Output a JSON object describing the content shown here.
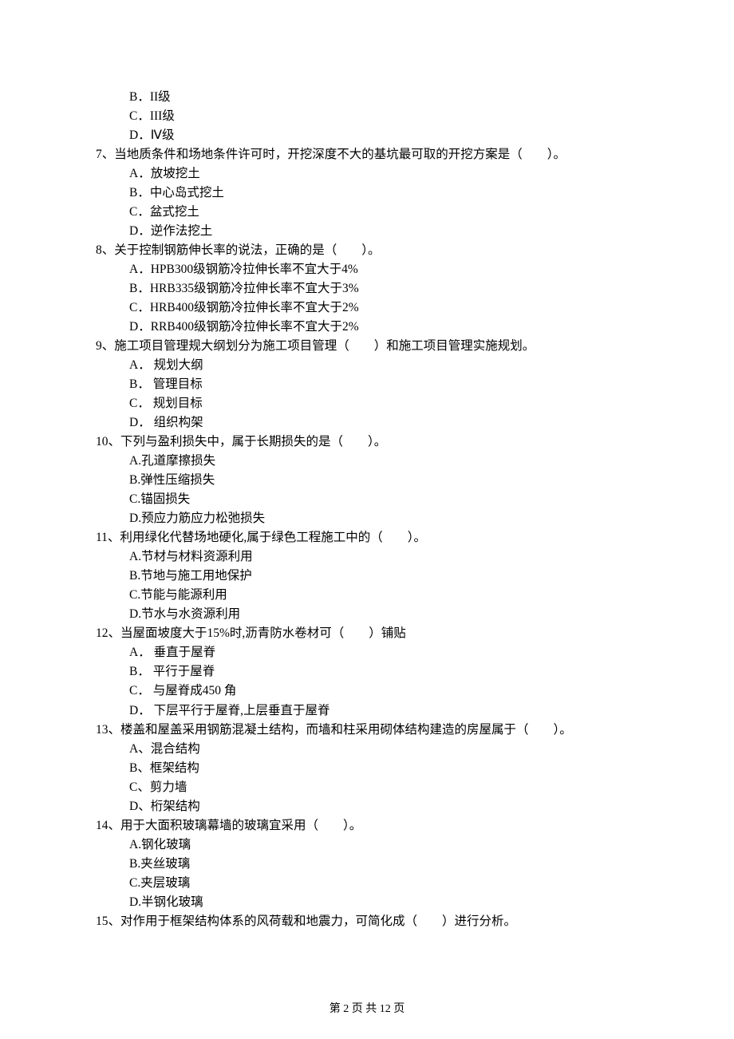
{
  "footer": "第 2 页 共 12 页",
  "opts_pre": [
    "B．II级",
    "C．III级",
    "D．Ⅳ级"
  ],
  "questions": [
    {
      "stem": "7、当地质条件和场地条件许可时，开挖深度不大的基坑最可取的开挖方案是（　　）。",
      "opts": [
        "A．放坡挖土",
        "B．中心岛式挖土",
        "C．盆式挖土",
        "D．逆作法挖土"
      ]
    },
    {
      "stem": "8、关于控制钢筋伸长率的说法，正确的是（　　）。",
      "opts": [
        "A．HPB300级钢筋冷拉伸长率不宜大于4%",
        "B．HRB335级钢筋冷拉伸长率不宜大于3%",
        "C．HRB400级钢筋冷拉伸长率不宜大于2%",
        "D．RRB400级钢筋冷拉伸长率不宜大于2%"
      ]
    },
    {
      "stem": "9、施工项目管理规大纲划分为施工项目管理（　　）和施工项目管理实施规划。",
      "opts": [
        "A． 规划大纲",
        "B． 管理目标",
        "C． 规划目标",
        "D． 组织构架"
      ]
    },
    {
      "stem": "10、下列与盈利损失中，属于长期损失的是（　　）。",
      "opts": [
        "A.孔道摩擦损失",
        "B.弹性压缩损失",
        "C.锚固损失",
        "D.预应力筋应力松弛损失"
      ]
    },
    {
      "stem": "11、利用绿化代替场地硬化,属于绿色工程施工中的（　　）。",
      "opts": [
        "A.节材与材料资源利用",
        "B.节地与施工用地保护",
        "C.节能与能源利用",
        "D.节水与水资源利用"
      ]
    },
    {
      "stem": "12、当屋面坡度大于15%时,沥青防水卷材可（　　）铺贴",
      "opts": [
        "A． 垂直于屋脊",
        "B． 平行于屋脊",
        "C． 与屋脊成450 角",
        "D． 下层平行于屋脊,上层垂直于屋脊"
      ]
    },
    {
      "stem": "13、楼盖和屋盖采用钢筋混凝土结构，而墙和柱采用砌体结构建造的房屋属于（　　）。",
      "opts": [
        "A、混合结构",
        "B、框架结构",
        "C、剪力墙",
        "D、桁架结构"
      ]
    },
    {
      "stem": "14、用于大面积玻璃幕墙的玻璃宜采用（　　）。",
      "opts": [
        "A.钢化玻璃",
        "B.夹丝玻璃",
        "C.夹层玻璃",
        "D.半钢化玻璃"
      ]
    },
    {
      "stem": "15、对作用于框架结构体系的风荷载和地震力，可简化成（　　）进行分析。",
      "opts": []
    }
  ]
}
